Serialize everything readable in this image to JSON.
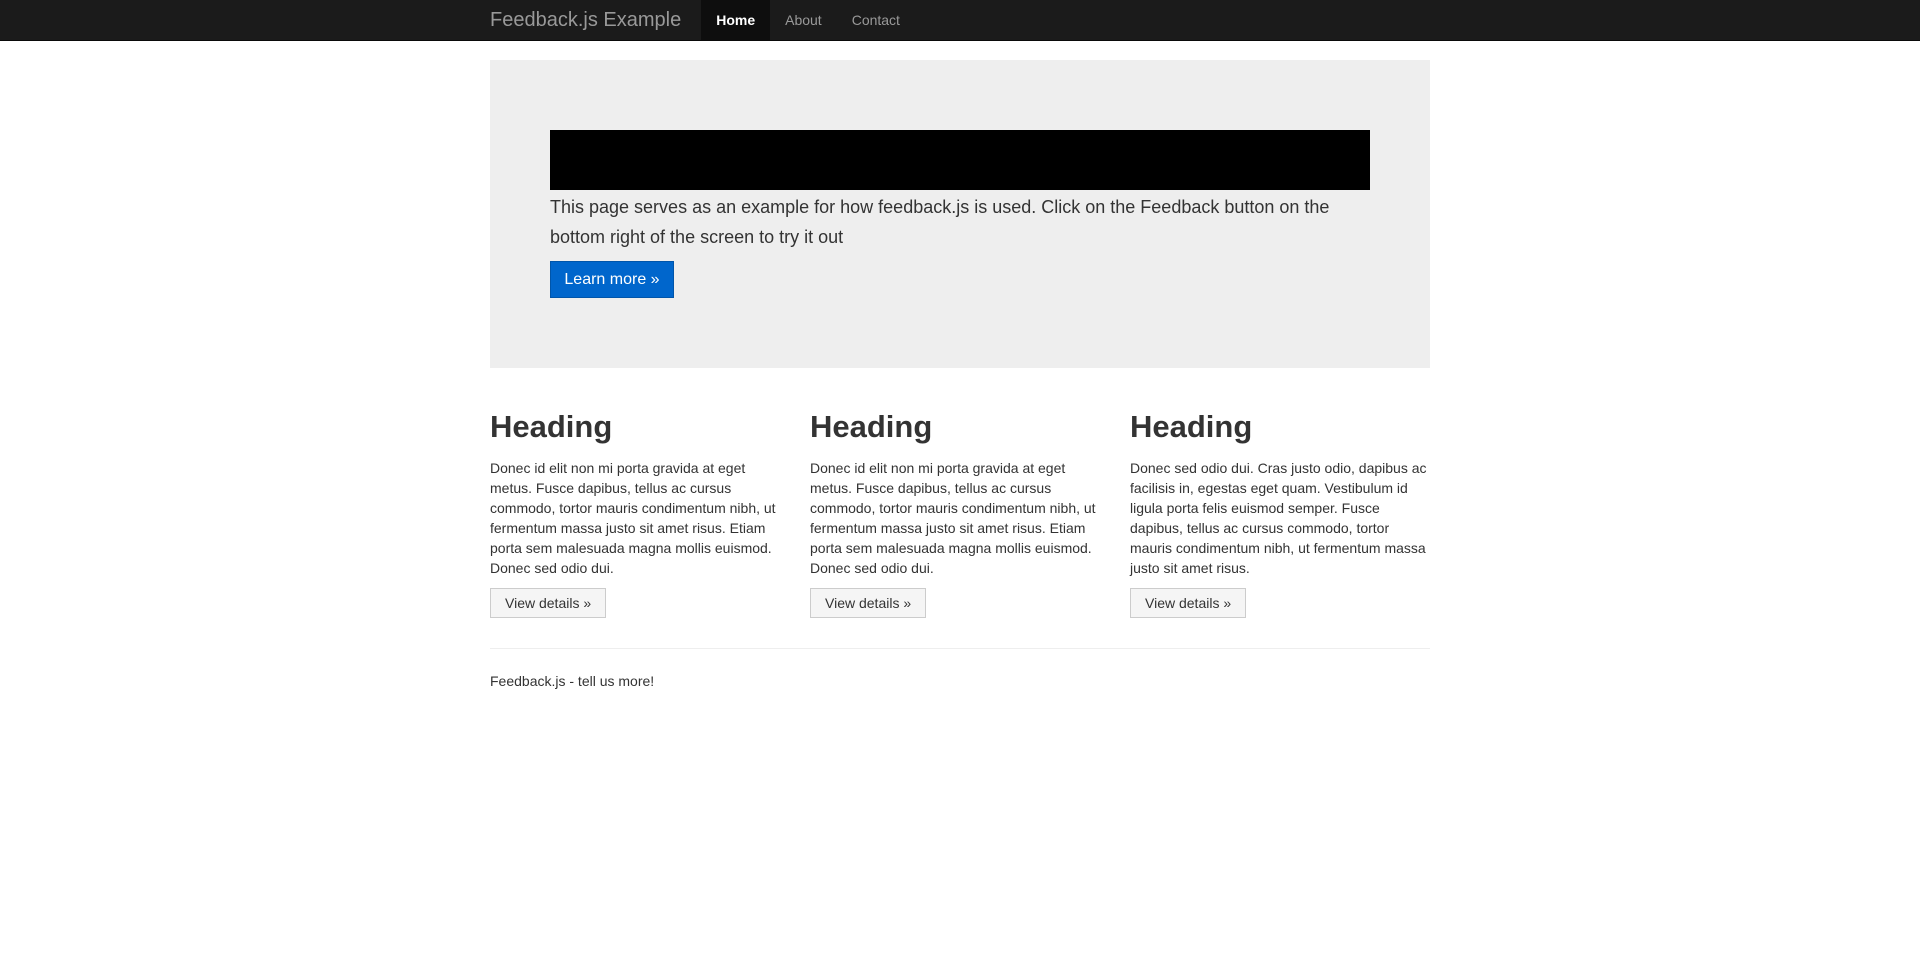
{
  "navbar": {
    "brand": "Feedback.js Example",
    "items": [
      {
        "label": "Home",
        "active": true
      },
      {
        "label": "About",
        "active": false
      },
      {
        "label": "Contact",
        "active": false
      }
    ]
  },
  "hero": {
    "lead": "This page serves as an example for how feedback.js is used. Click on the Feedback button on the bottom right of the screen to try it out",
    "button_label": "Learn more »"
  },
  "columns": [
    {
      "heading": "Heading",
      "text": "Donec id elit non mi porta gravida at eget metus. Fusce dapibus, tellus ac cursus commodo, tortor mauris condimentum nibh, ut fermentum massa justo sit amet risus. Etiam porta sem malesuada magna mollis euismod. Donec sed odio dui.",
      "button_label": "View details »"
    },
    {
      "heading": "Heading",
      "text": "Donec id elit non mi porta gravida at eget metus. Fusce dapibus, tellus ac cursus commodo, tortor mauris condimentum nibh, ut fermentum massa justo sit amet risus. Etiam porta sem malesuada magna mollis euismod. Donec sed odio dui.",
      "button_label": "View details »"
    },
    {
      "heading": "Heading",
      "text": "Donec sed odio dui. Cras justo odio, dapibus ac facilisis in, egestas eget quam. Vestibulum id ligula porta felis euismod semper. Fusce dapibus, tellus ac cursus commodo, tortor mauris condimentum nibh, ut fermentum massa justo sit amet risus.",
      "button_label": "View details »"
    }
  ],
  "footer": {
    "text": "Feedback.js - tell us more!"
  },
  "colors": {
    "navbar_bg": "#1b1b1b",
    "hero_bg": "#eeeeee",
    "primary_button": "#0066cc"
  }
}
